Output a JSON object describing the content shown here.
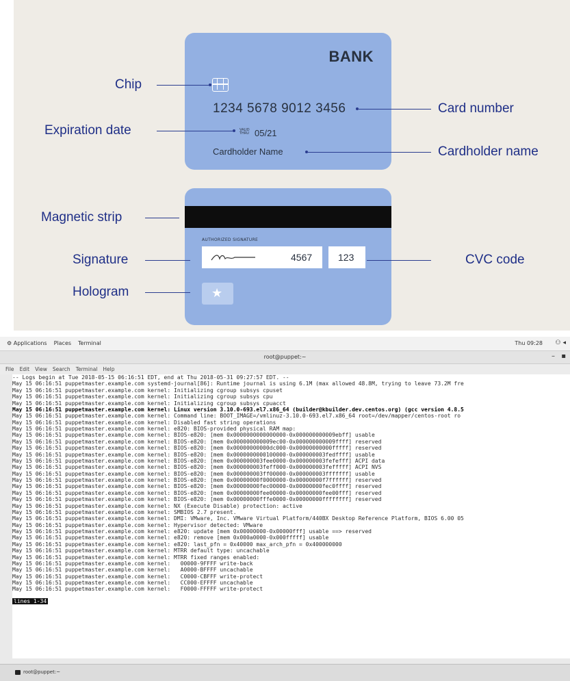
{
  "diagram": {
    "front": {
      "bank": "BANK",
      "card_number": "1234 5678 9012 3456",
      "valid_top": "VALID",
      "valid_bottom": "THRU",
      "expiry": "05/21",
      "holder": "Cardholder Name"
    },
    "back": {
      "authorized_signature": "AUTHORIZED SIGNATURE",
      "signature_digits": "4567",
      "cvc": "123",
      "hologram_icon": "star-icon"
    },
    "labels": {
      "chip": "Chip",
      "expiration_date": "Expiration date",
      "card_number": "Card number",
      "cardholder_name": "Cardholder name",
      "magnetic_strip": "Magnetic strip",
      "signature": "Signature",
      "cvc_code": "CVC code",
      "hologram": "Hologram"
    },
    "colors": {
      "background": "#efece6",
      "card": "#93b0e2",
      "label": "#1f2f87"
    }
  },
  "desktop": {
    "topbar": {
      "applications": "Applications",
      "places": "Places",
      "terminal": "Terminal",
      "clock": "Thu 09:28"
    },
    "window": {
      "title": "root@puppet:~",
      "menu": [
        "File",
        "Edit",
        "View",
        "Search",
        "Terminal",
        "Help"
      ]
    },
    "log_lines": [
      "-- Logs begin at Tue 2018-05-15 06:16:51 EDT, end at Thu 2018-05-31 09:27:57 EDT. --",
      "May 15 06:16:51 puppetmaster.example.com systemd-journal[86]: Runtime journal is using 6.1M (max allowed 48.8M, trying to leave 73.2M fre",
      "May 15 06:16:51 puppetmaster.example.com kernel: Initializing cgroup subsys cpuset",
      "May 15 06:16:51 puppetmaster.example.com kernel: Initializing cgroup subsys cpu",
      "May 15 06:16:51 puppetmaster.example.com kernel: Initializing cgroup subsys cpuacct",
      "May 15 06:16:51 puppetmaster.example.com kernel: Linux version 3.10.0-693.el7.x86_64 (builder@kbuilder.dev.centos.org) (gcc version 4.8.5",
      "May 15 06:16:51 puppetmaster.example.com kernel: Command line: BOOT_IMAGE=/vmlinuz-3.10.0-693.el7.x86_64 root=/dev/mapper/centos-root ro",
      "May 15 06:16:51 puppetmaster.example.com kernel: Disabled fast string operations",
      "May 15 06:16:51 puppetmaster.example.com kernel: e820: BIOS-provided physical RAM map:",
      "May 15 06:16:51 puppetmaster.example.com kernel: BIOS-e820: [mem 0x0000000000000000-0x000000000009ebff] usable",
      "May 15 06:16:51 puppetmaster.example.com kernel: BIOS-e820: [mem 0x000000000009ec00-0x000000000009ffff] reserved",
      "May 15 06:16:51 puppetmaster.example.com kernel: BIOS-e820: [mem 0x00000000000dc000-0x00000000000fffff] reserved",
      "May 15 06:16:51 puppetmaster.example.com kernel: BIOS-e820: [mem 0x0000000000100000-0x000000003fedffff] usable",
      "May 15 06:16:51 puppetmaster.example.com kernel: BIOS-e820: [mem 0x000000003fee0000-0x000000003fefefff] ACPI data",
      "May 15 06:16:51 puppetmaster.example.com kernel: BIOS-e820: [mem 0x000000003feff000-0x000000003fefffff] ACPI NVS",
      "May 15 06:16:51 puppetmaster.example.com kernel: BIOS-e820: [mem 0x000000003ff00000-0x000000003fffffff] usable",
      "May 15 06:16:51 puppetmaster.example.com kernel: BIOS-e820: [mem 0x00000000f0000000-0x00000000f7ffffff] reserved",
      "May 15 06:16:51 puppetmaster.example.com kernel: BIOS-e820: [mem 0x00000000fec00000-0x00000000fec0ffff] reserved",
      "May 15 06:16:51 puppetmaster.example.com kernel: BIOS-e820: [mem 0x00000000fee00000-0x00000000fee00fff] reserved",
      "May 15 06:16:51 puppetmaster.example.com kernel: BIOS-e820: [mem 0x00000000fffe0000-0x00000000ffffffff] reserved",
      "May 15 06:16:51 puppetmaster.example.com kernel: NX (Execute Disable) protection: active",
      "May 15 06:16:51 puppetmaster.example.com kernel: SMBIOS 2.7 present.",
      "May 15 06:16:51 puppetmaster.example.com kernel: DMI: VMware, Inc. VMware Virtual Platform/440BX Desktop Reference Platform, BIOS 6.00 05",
      "May 15 06:16:51 puppetmaster.example.com kernel: Hypervisor detected: VMware",
      "May 15 06:16:51 puppetmaster.example.com kernel: e820: update [mem 0x00000000-0x00000fff] usable ==> reserved",
      "May 15 06:16:51 puppetmaster.example.com kernel: e820: remove [mem 0x000a0000-0x000fffff] usable",
      "May 15 06:16:51 puppetmaster.example.com kernel: e820: last_pfn = 0x40000 max_arch_pfn = 0x400000000",
      "May 15 06:16:51 puppetmaster.example.com kernel: MTRR default type: uncachable",
      "May 15 06:16:51 puppetmaster.example.com kernel: MTRR fixed ranges enabled:",
      "May 15 06:16:51 puppetmaster.example.com kernel:   00000-9FFFF write-back",
      "May 15 06:16:51 puppetmaster.example.com kernel:   A0000-BFFFF uncachable",
      "May 15 06:16:51 puppetmaster.example.com kernel:   C0000-CBFFF write-protect",
      "May 15 06:16:51 puppetmaster.example.com kernel:   CC000-EFFFF uncachable",
      "May 15 06:16:51 puppetmaster.example.com kernel:   F0000-FFFFF write-protect"
    ],
    "bold_line_index": 5,
    "pager_status": "lines 1-34",
    "taskbar_item": "root@puppet:~"
  }
}
